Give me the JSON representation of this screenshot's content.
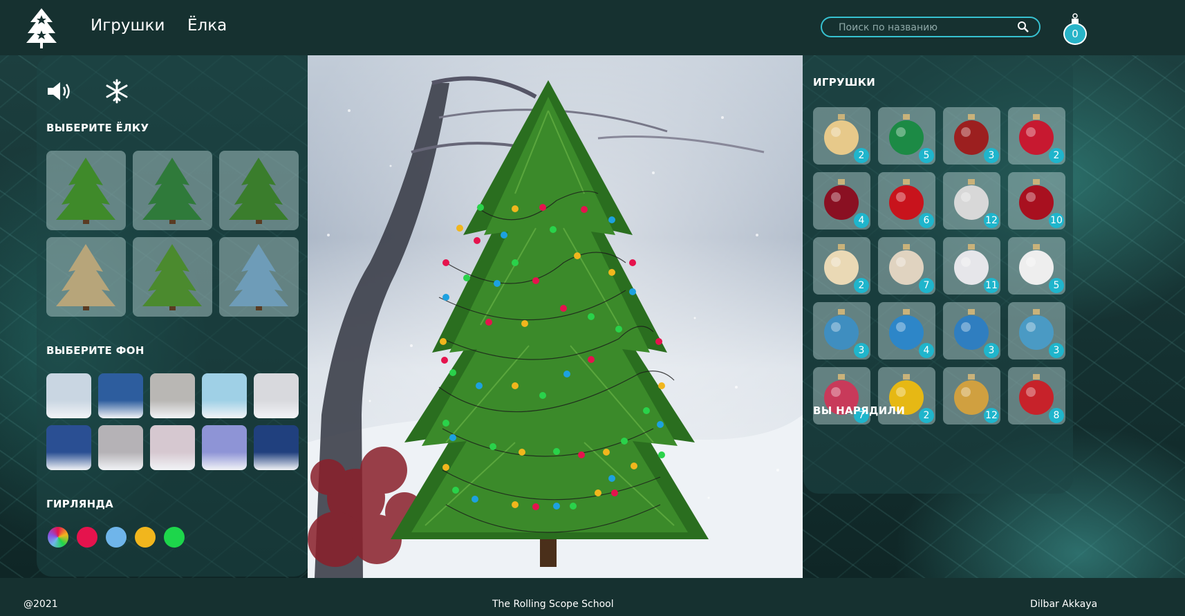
{
  "header": {
    "nav": [
      "Игрушки",
      "Ёлка"
    ],
    "search_placeholder": "Поиск по названию",
    "cart_count": "0"
  },
  "left": {
    "tree_title": "ВЫБЕРИТЕ ЁЛКУ",
    "bg_title": "ВЫБЕРИТЕ ФОН",
    "garland_title": "ГИРЛЯНДА",
    "icons": [
      "sound-icon",
      "snowflake-icon"
    ],
    "trees": [
      "#3f8a2a",
      "#2f7a3a",
      "#3a7d2c",
      "#b7a57a",
      "#4b8a2e",
      "#6e9cb8"
    ],
    "backgrounds": [
      "#c9d6e2",
      "#2d5d9e",
      "#b9b7b4",
      "#9fd0e6",
      "#d8d9dd",
      "#2a4f93",
      "#b5b2b6",
      "#d6c8d0",
      "#8e94d6",
      "#20407e"
    ],
    "garland_colors": [
      "multicolor",
      "#e5134d",
      "#6fb5ea",
      "#f1b61d",
      "#1dd64b"
    ]
  },
  "right": {
    "toys_title": "ИГРУШКИ",
    "decorated_title": "ВЫ НАРЯДИЛИ",
    "toys": [
      {
        "count": "2",
        "color": "#e7c98a"
      },
      {
        "count": "5",
        "color": "#1c8a45"
      },
      {
        "count": "3",
        "color": "#9c1f1f"
      },
      {
        "count": "2",
        "color": "#c71930"
      },
      {
        "count": "4",
        "color": "#8a1022"
      },
      {
        "count": "6",
        "color": "#c8131c"
      },
      {
        "count": "12",
        "color": "#d8d8d8"
      },
      {
        "count": "10",
        "color": "#a8101f"
      },
      {
        "count": "2",
        "color": "#ead9b5"
      },
      {
        "count": "7",
        "color": "#e0d3c0"
      },
      {
        "count": "11",
        "color": "#e6e6ea"
      },
      {
        "count": "5",
        "color": "#eeeeee"
      },
      {
        "count": "3",
        "color": "#3f8ec0"
      },
      {
        "count": "4",
        "color": "#2d86c8"
      },
      {
        "count": "3",
        "color": "#2f7ec0"
      },
      {
        "count": "3",
        "color": "#4a9ac4"
      },
      {
        "count": "7",
        "color": "#c83a5a"
      },
      {
        "count": "2",
        "color": "#e6b814"
      },
      {
        "count": "12",
        "color": "#d0a040"
      },
      {
        "count": "8",
        "color": "#c7222a"
      }
    ]
  },
  "footer": {
    "copyright": "@2021",
    "school": "The Rolling Scope School",
    "author": "Dilbar Akkaya"
  }
}
